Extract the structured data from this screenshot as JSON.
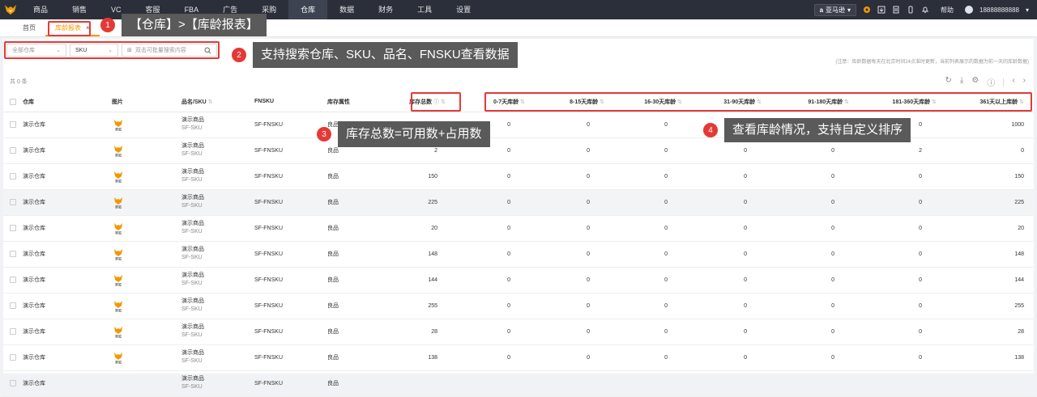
{
  "nav": {
    "items": [
      "商品",
      "销售",
      "VC",
      "客服",
      "FBA",
      "广告",
      "采购",
      "仓库",
      "数据",
      "财务",
      "工具",
      "设置"
    ],
    "active_index": 7,
    "region": "亚马逊",
    "help": "帮助",
    "user": "18888888888"
  },
  "tabs": {
    "home": "首页",
    "current": "库龄报表",
    "close": "×"
  },
  "filters": {
    "warehouse": "全部仓库",
    "field": "SKU",
    "search_placeholder": "双击可批量搜索内容"
  },
  "notice": "(注意：库龄数据每天在北京时间24点准时更新，当前列表展示的数据为前一天的库龄数据)",
  "count": "共 0 条",
  "columns": {
    "warehouse": "仓库",
    "image": "图片",
    "name_sku": "品名/SKU",
    "fnsku": "FNSKU",
    "attr": "库存属性",
    "total": "库存总数",
    "ages": [
      "0-7天库龄",
      "8-15天库龄",
      "16-30天库龄",
      "31-90天库龄",
      "91-180天库龄",
      "181-360天库龄",
      "361天以上库龄"
    ]
  },
  "rows": [
    {
      "warehouse": "演示仓库",
      "thumb": "赛狐",
      "name": "演示商品",
      "sku": "SF-SKU",
      "fnsku": "SF-FNSKU",
      "attr": "良品",
      "total": "1000",
      "ages": [
        "0",
        "0",
        "0",
        "0",
        "0",
        "0",
        "1000"
      ]
    },
    {
      "warehouse": "演示仓库",
      "thumb": "赛狐",
      "name": "演示商品",
      "sku": "SF-SKU",
      "fnsku": "SF-FNSKU",
      "attr": "良品",
      "total": "2",
      "ages": [
        "0",
        "0",
        "0",
        "0",
        "0",
        "2",
        "0"
      ]
    },
    {
      "warehouse": "演示仓库",
      "thumb": "赛狐",
      "name": "演示商品",
      "sku": "SF-SKU",
      "fnsku": "SF-FNSKU",
      "attr": "良品",
      "total": "150",
      "ages": [
        "0",
        "0",
        "0",
        "0",
        "0",
        "0",
        "150"
      ]
    },
    {
      "warehouse": "演示仓库",
      "thumb": "赛狐",
      "name": "演示商品",
      "sku": "SF-SKU",
      "fnsku": "SF-FNSKU",
      "attr": "良品",
      "total": "225",
      "ages": [
        "0",
        "0",
        "0",
        "0",
        "0",
        "0",
        "225"
      ]
    },
    {
      "warehouse": "演示仓库",
      "thumb": "赛狐",
      "name": "演示商品",
      "sku": "SF-SKU",
      "fnsku": "SF-FNSKU",
      "attr": "良品",
      "total": "20",
      "ages": [
        "0",
        "0",
        "0",
        "0",
        "0",
        "0",
        "20"
      ]
    },
    {
      "warehouse": "演示仓库",
      "thumb": "赛狐",
      "name": "演示商品",
      "sku": "SF-SKU",
      "fnsku": "SF-FNSKU",
      "attr": "良品",
      "total": "148",
      "ages": [
        "0",
        "0",
        "0",
        "0",
        "0",
        "0",
        "148"
      ]
    },
    {
      "warehouse": "演示仓库",
      "thumb": "赛狐",
      "name": "演示商品",
      "sku": "SF-SKU",
      "fnsku": "SF-FNSKU",
      "attr": "良品",
      "total": "144",
      "ages": [
        "0",
        "0",
        "0",
        "0",
        "0",
        "0",
        "144"
      ]
    },
    {
      "warehouse": "演示仓库",
      "thumb": "赛狐",
      "name": "演示商品",
      "sku": "SF-SKU",
      "fnsku": "SF-FNSKU",
      "attr": "良品",
      "total": "255",
      "ages": [
        "0",
        "0",
        "0",
        "0",
        "0",
        "0",
        "255"
      ]
    },
    {
      "warehouse": "演示仓库",
      "thumb": "赛狐",
      "name": "演示商品",
      "sku": "SF-SKU",
      "fnsku": "SF-FNSKU",
      "attr": "良品",
      "total": "28",
      "ages": [
        "0",
        "0",
        "0",
        "0",
        "0",
        "0",
        "28"
      ]
    },
    {
      "warehouse": "演示仓库",
      "thumb": "赛狐",
      "name": "演示商品",
      "sku": "SF-SKU",
      "fnsku": "SF-FNSKU",
      "attr": "良品",
      "total": "138",
      "ages": [
        "0",
        "0",
        "0",
        "0",
        "0",
        "0",
        "138"
      ]
    },
    {
      "warehouse": "演示仓库",
      "thumb": "赛狐",
      "name": "演示商品",
      "sku": "SF-SKU",
      "fnsku": "SF-FNSKU",
      "attr": "良品",
      "total": "",
      "ages": [
        "",
        "",
        "",
        "",
        "",
        "",
        ""
      ]
    }
  ],
  "callouts": [
    {
      "num": "1",
      "text": "【仓库】>【库龄报表】"
    },
    {
      "num": "2",
      "text": "支持搜索仓库、SKU、品名、FNSKU查看数据"
    },
    {
      "num": "3",
      "text": "库存总数=可用数+占用数"
    },
    {
      "num": "4",
      "text": "查看库龄情况，支持自定义排序"
    }
  ],
  "colors": {
    "accent": "#f39800",
    "nav_bg": "#2b2f3a",
    "highlight": "#e53935",
    "callout_bg": "#5a5a5a"
  }
}
